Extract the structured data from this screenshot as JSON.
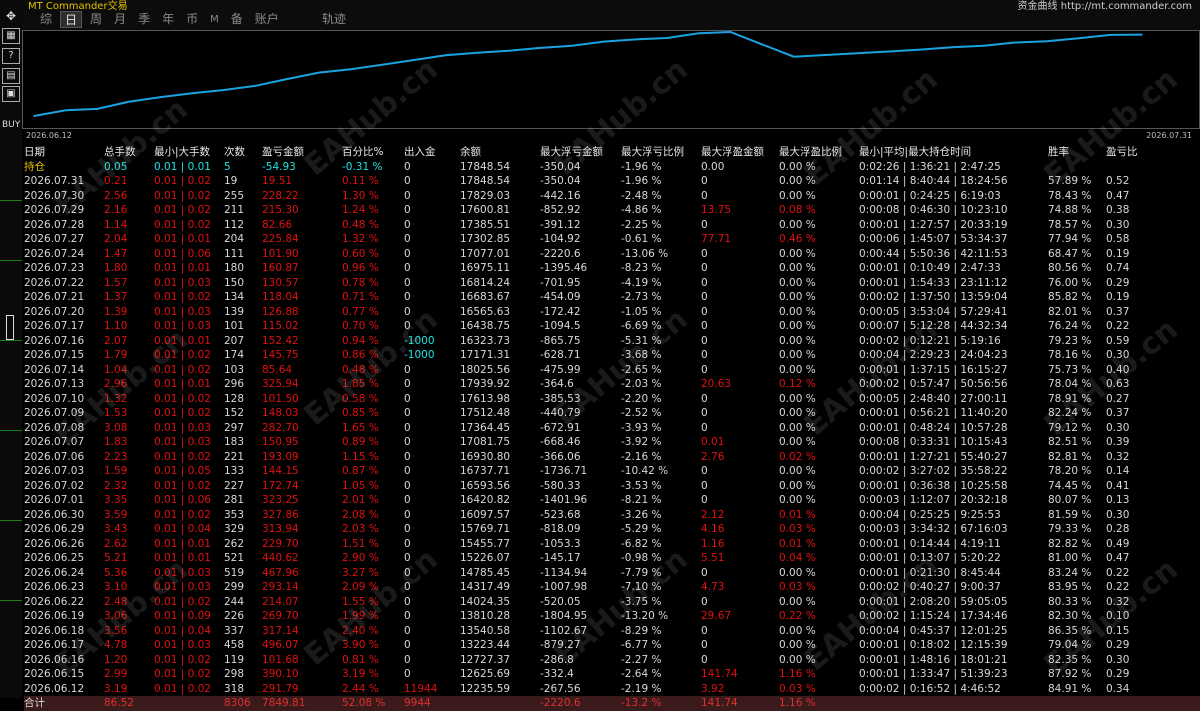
{
  "app": {
    "brand": "MT Commander交易",
    "top_right": "资金曲线 http://mt.commander.com"
  },
  "toolbar": {
    "tabs": [
      "综",
      "日",
      "周",
      "月",
      "季",
      "年",
      "币",
      "M",
      "备",
      "账户"
    ],
    "active_tab": "日",
    "trajectory_label": "轨迹"
  },
  "left_tools": {
    "move_icon": "move-icon",
    "buy_label": "BUY"
  },
  "chart_data": {
    "type": "line",
    "title": "",
    "x_start_label": "2026.06.12",
    "x_end_label": "2026.07.31",
    "x": [
      "2026.06.12",
      "2026.06.15",
      "2026.06.16",
      "2026.06.17",
      "2026.06.18",
      "2026.06.19",
      "2026.06.22",
      "2026.06.23",
      "2026.06.24",
      "2026.06.25",
      "2026.06.26",
      "2026.06.29",
      "2026.06.30",
      "2026.07.01",
      "2026.07.02",
      "2026.07.03",
      "2026.07.06",
      "2026.07.07",
      "2026.07.08",
      "2026.07.09",
      "2026.07.10",
      "2026.07.13",
      "2026.07.14",
      "2026.07.15",
      "2026.07.16",
      "2026.07.17",
      "2026.07.20",
      "2026.07.21",
      "2026.07.22",
      "2026.07.23",
      "2026.07.24",
      "2026.07.27",
      "2026.07.28",
      "2026.07.29",
      "2026.07.30",
      "2026.07.31"
    ],
    "values": [
      12235.59,
      12625.69,
      12727.37,
      13223.44,
      13540.58,
      13810.28,
      14024.35,
      14317.49,
      14785.45,
      15226.07,
      15455.77,
      15769.71,
      16097.57,
      16420.82,
      16593.56,
      16737.71,
      16930.8,
      17081.75,
      17364.45,
      17512.48,
      17613.98,
      17939.92,
      18025.56,
      17171.31,
      16323.73,
      16438.75,
      16565.63,
      16683.67,
      16814.24,
      16975.11,
      17077.01,
      17302.85,
      17385.51,
      17600.81,
      17829.03,
      17848.54
    ],
    "line_color": "#1aa3e0"
  },
  "table": {
    "headers": [
      "日期",
      "总手数",
      "最小|大手数",
      "次数",
      "盈亏金额",
      "百分比%",
      "出入金",
      "余额",
      "最大浮亏金额",
      "最大浮亏比例",
      "最大浮盈金额",
      "最大浮盈比例",
      "最小|平均|最大持仓时间",
      "胜率",
      "盈亏比"
    ],
    "rows": [
      [
        "持仓",
        "0.05",
        "0.01 | 0.01",
        "5",
        "-54.93",
        "-0.31 %",
        "0",
        "17848.54",
        "-350.04",
        "-1.96 %",
        "0.00",
        "0.00 %",
        "0:02:26 | 1:36:21 | 2:47:25",
        "",
        ""
      ],
      [
        "2026.07.31",
        "0.21",
        "0.01 | 0.02",
        "19",
        "19.51",
        "0.11 %",
        "0",
        "17848.54",
        "-350.04",
        "-1.96 %",
        "0",
        "0.00 %",
        "0:01:14 | 8:40:44 | 18:24:56",
        "57.89 %",
        "0.52"
      ],
      [
        "2026.07.30",
        "2.56",
        "0.01 | 0.02",
        "255",
        "228.22",
        "1.30 %",
        "0",
        "17829.03",
        "-442.16",
        "-2.48 %",
        "0",
        "0.00 %",
        "0:00:01 | 0:24:25 | 6:19:03",
        "78.43 %",
        "0.47"
      ],
      [
        "2026.07.29",
        "2.16",
        "0.01 | 0.02",
        "211",
        "215.30",
        "1.24 %",
        "0",
        "17600.81",
        "-852.92",
        "-4.86 %",
        "13.75",
        "0.08 %",
        "0:00:08 | 0:46:30 | 10:23:10",
        "74.88 %",
        "0.38"
      ],
      [
        "2026.07.28",
        "1.14",
        "0.01 | 0.02",
        "112",
        "82.66",
        "0.48 %",
        "0",
        "17385.51",
        "-391.12",
        "-2.25 %",
        "0",
        "0.00 %",
        "0:00:01 | 1:27:57 | 20:33:19",
        "78.57 %",
        "0.30"
      ],
      [
        "2026.07.27",
        "2.04",
        "0.01 | 0.01",
        "204",
        "225.84",
        "1.32 %",
        "0",
        "17302.85",
        "-104.92",
        "-0.61 %",
        "77.71",
        "0.46 %",
        "0:00:06 | 1:45:07 | 53:34:37",
        "77.94 %",
        "0.58"
      ],
      [
        "2026.07.24",
        "1.47",
        "0.01 | 0.06",
        "111",
        "101.90",
        "0.60 %",
        "0",
        "17077.01",
        "-2220.6",
        "-13.06 %",
        "0",
        "0.00 %",
        "0:00:44 | 5:50:36 | 42:11:53",
        "68.47 %",
        "0.19"
      ],
      [
        "2026.07.23",
        "1.80",
        "0.01 | 0.01",
        "180",
        "160.87",
        "0.96 %",
        "0",
        "16975.11",
        "-1395.46",
        "-8.23 %",
        "0",
        "0.00 %",
        "0:00:01 | 0:10:49 | 2:47:33",
        "80.56 %",
        "0.74"
      ],
      [
        "2026.07.22",
        "1.57",
        "0.01 | 0.03",
        "150",
        "130.57",
        "0.78 %",
        "0",
        "16814.24",
        "-701.95",
        "-4.19 %",
        "0",
        "0.00 %",
        "0:00:01 | 1:54:33 | 23:11:12",
        "76.00 %",
        "0.29"
      ],
      [
        "2026.07.21",
        "1.37",
        "0.01 | 0.02",
        "134",
        "118.04",
        "0.71 %",
        "0",
        "16683.67",
        "-454.09",
        "-2.73 %",
        "0",
        "0.00 %",
        "0:00:02 | 1:37:50 | 13:59:04",
        "85.82 %",
        "0.19"
      ],
      [
        "2026.07.20",
        "1.39",
        "0.01 | 0.03",
        "139",
        "126.88",
        "0.77 %",
        "0",
        "16565.63",
        "-172.42",
        "-1.05 %",
        "0",
        "0.00 %",
        "0:00:05 | 3:53:04 | 57:29:41",
        "82.01 %",
        "0.37"
      ],
      [
        "2026.07.17",
        "1.10",
        "0.01 | 0.03",
        "101",
        "115.02",
        "0.70 %",
        "0",
        "16438.75",
        "-1094.5",
        "-6.69 %",
        "0",
        "0.00 %",
        "0:00:07 | 5:12:28 | 44:32:34",
        "76.24 %",
        "0.22"
      ],
      [
        "2026.07.16",
        "2.07",
        "0.01 | 0.01",
        "207",
        "152.42",
        "0.94 %",
        "-1000",
        "16323.73",
        "-865.75",
        "-5.31 %",
        "0",
        "0.00 %",
        "0:00:02 | 0:12:21 | 5:19:16",
        "79.23 %",
        "0.59"
      ],
      [
        "2026.07.15",
        "1.79",
        "0.01 | 0.02",
        "174",
        "145.75",
        "0.86 %",
        "-1000",
        "17171.31",
        "-628.71",
        "-3.68 %",
        "0",
        "0.00 %",
        "0:00:04 | 2:29:23 | 24:04:23",
        "78.16 %",
        "0.30"
      ],
      [
        "2026.07.14",
        "1.04",
        "0.01 | 0.02",
        "103",
        "85.64",
        "0.48 %",
        "0",
        "18025.56",
        "-475.99",
        "-2.65 %",
        "0",
        "0.00 %",
        "0:00:01 | 1:37:15 | 16:15:27",
        "75.73 %",
        "0.40"
      ],
      [
        "2026.07.13",
        "2.96",
        "0.01 | 0.01",
        "296",
        "325.94",
        "1.85 %",
        "0",
        "17939.92",
        "-364.6",
        "-2.03 %",
        "20.63",
        "0.12 %",
        "0:00:02 | 0:57:47 | 50:56:56",
        "78.04 %",
        "0.63"
      ],
      [
        "2026.07.10",
        "1.32",
        "0.01 | 0.02",
        "128",
        "101.50",
        "0.58 %",
        "0",
        "17613.98",
        "-385.53",
        "-2.20 %",
        "0",
        "0.00 %",
        "0:00:05 | 2:48:40 | 27:00:11",
        "78.91 %",
        "0.27"
      ],
      [
        "2026.07.09",
        "1.53",
        "0.01 | 0.02",
        "152",
        "148.03",
        "0.85 %",
        "0",
        "17512.48",
        "-440.79",
        "-2.52 %",
        "0",
        "0.00 %",
        "0:00:01 | 0:56:21 | 11:40:20",
        "82.24 %",
        "0.37"
      ],
      [
        "2026.07.08",
        "3.08",
        "0.01 | 0.03",
        "297",
        "282.70",
        "1.65 %",
        "0",
        "17364.45",
        "-672.91",
        "-3.93 %",
        "0",
        "0.00 %",
        "0:00:01 | 0:48:24 | 10:57:28",
        "79.12 %",
        "0.30"
      ],
      [
        "2026.07.07",
        "1.83",
        "0.01 | 0.03",
        "183",
        "150.95",
        "0.89 %",
        "0",
        "17081.75",
        "-668.46",
        "-3.92 %",
        "0.01",
        "0.00 %",
        "0:00:08 | 0:33:31 | 10:15:43",
        "82.51 %",
        "0.39"
      ],
      [
        "2026.07.06",
        "2.23",
        "0.01 | 0.02",
        "221",
        "193.09",
        "1.15 %",
        "0",
        "16930.80",
        "-366.06",
        "-2.16 %",
        "2.76",
        "0.02 %",
        "0:00:01 | 1:27:21 | 55:40:27",
        "82.81 %",
        "0.32"
      ],
      [
        "2026.07.03",
        "1.59",
        "0.01 | 0.05",
        "133",
        "144.15",
        "0.87 %",
        "0",
        "16737.71",
        "-1736.71",
        "-10.42 %",
        "0",
        "0.00 %",
        "0:00:02 | 3:27:02 | 35:58:22",
        "78.20 %",
        "0.14"
      ],
      [
        "2026.07.02",
        "2.32",
        "0.01 | 0.02",
        "227",
        "172.74",
        "1.05 %",
        "0",
        "16593.56",
        "-580.33",
        "-3.53 %",
        "0",
        "0.00 %",
        "0:00:01 | 0:36:38 | 10:25:58",
        "74.45 %",
        "0.41"
      ],
      [
        "2026.07.01",
        "3.35",
        "0.01 | 0.06",
        "281",
        "323.25",
        "2.01 %",
        "0",
        "16420.82",
        "-1401.96",
        "-8.21 %",
        "0",
        "0.00 %",
        "0:00:03 | 1:12:07 | 20:32:18",
        "80.07 %",
        "0.13"
      ],
      [
        "2026.06.30",
        "3.59",
        "0.01 | 0.02",
        "353",
        "327.86",
        "2.08 %",
        "0",
        "16097.57",
        "-523.68",
        "-3.26 %",
        "2.12",
        "0.01 %",
        "0:00:04 | 0:25:25 | 9:25:53",
        "81.59 %",
        "0.30"
      ],
      [
        "2026.06.29",
        "3.43",
        "0.01 | 0.04",
        "329",
        "313.94",
        "2.03 %",
        "0",
        "15769.71",
        "-818.09",
        "-5.29 %",
        "4.16",
        "0.03 %",
        "0:00:03 | 3:34:32 | 67:16:03",
        "79.33 %",
        "0.28"
      ],
      [
        "2026.06.26",
        "2.62",
        "0.01 | 0.01",
        "262",
        "229.70",
        "1.51 %",
        "0",
        "15455.77",
        "-1053.3",
        "-6.82 %",
        "1.16",
        "0.01 %",
        "0:00:01 | 0:14:44 | 4:19:11",
        "82.82 %",
        "0.49"
      ],
      [
        "2026.06.25",
        "5.21",
        "0.01 | 0.01",
        "521",
        "440.62",
        "2.90 %",
        "0",
        "15226.07",
        "-145.17",
        "-0.98 %",
        "5.51",
        "0.04 %",
        "0:00:01 | 0:13:07 | 5:20:22",
        "81.00 %",
        "0.47"
      ],
      [
        "2026.06.24",
        "5.36",
        "0.01 | 0.03",
        "519",
        "467.96",
        "3.27 %",
        "0",
        "14785.45",
        "-1134.94",
        "-7.79 %",
        "0",
        "0.00 %",
        "0:00:01 | 0:21:30 | 8:45:44",
        "83.24 %",
        "0.22"
      ],
      [
        "2026.06.23",
        "3.10",
        "0.01 | 0.03",
        "299",
        "293.14",
        "2.09 %",
        "0",
        "14317.49",
        "-1007.98",
        "-7.10 %",
        "4.73",
        "0.03 %",
        "0:00:02 | 0:40:27 | 9:00:37",
        "83.95 %",
        "0.22"
      ],
      [
        "2026.06.22",
        "2.48",
        "0.01 | 0.02",
        "244",
        "214.07",
        "1.55 %",
        "0",
        "14024.35",
        "-520.05",
        "-3.75 %",
        "0",
        "0.00 %",
        "0:00:01 | 2:08:20 | 59:05:05",
        "80.33 %",
        "0.32"
      ],
      [
        "2026.06.19",
        "3.06",
        "0.01 | 0.09",
        "226",
        "269.70",
        "1.99 %",
        "0",
        "13810.28",
        "-1804.95",
        "-13.20 %",
        "29.67",
        "0.22 %",
        "0:00:02 | 1:15:24 | 17:34:46",
        "82.30 %",
        "0.10"
      ],
      [
        "2026.06.18",
        "3.56",
        "0.01 | 0.04",
        "337",
        "317.14",
        "2.40 %",
        "0",
        "13540.58",
        "-1102.67",
        "-8.29 %",
        "0",
        "0.00 %",
        "0:00:04 | 0:45:37 | 12:01:25",
        "86.35 %",
        "0.15"
      ],
      [
        "2026.06.17",
        "4.78",
        "0.01 | 0.03",
        "458",
        "496.07",
        "3.90 %",
        "0",
        "13223.44",
        "-879.27",
        "-6.77 %",
        "0",
        "0.00 %",
        "0:00:01 | 0:18:02 | 12:15:39",
        "79.04 %",
        "0.29"
      ],
      [
        "2026.06.16",
        "1.20",
        "0.01 | 0.02",
        "119",
        "101.68",
        "0.81 %",
        "0",
        "12727.37",
        "-286.8",
        "-2.27 %",
        "0",
        "0.00 %",
        "0:00:01 | 1:48:16 | 18:01:21",
        "82.35 %",
        "0.30"
      ],
      [
        "2026.06.15",
        "2.99",
        "0.01 | 0.02",
        "298",
        "390.10",
        "3.19 %",
        "0",
        "12625.69",
        "-332.4",
        "-2.64 %",
        "141.74",
        "1.16 %",
        "0:00:01 | 1:33:47 | 51:39:23",
        "87.92 %",
        "0.29"
      ],
      [
        "2026.06.12",
        "3.19",
        "0.01 | 0.02",
        "318",
        "291.79",
        "2.44 %",
        "11944",
        "12235.59",
        "-267.56",
        "-2.19 %",
        "3.92",
        "0.03 %",
        "0:00:02 | 0:16:52 | 4:46:52",
        "84.91 %",
        "0.34"
      ]
    ],
    "summary": [
      "合计",
      "86.52",
      "",
      "8306",
      "7849.81",
      "52.08 %",
      "9944",
      "",
      "-2220.6",
      "-13.2 %",
      "141.74",
      "1.16 %",
      "",
      "",
      ""
    ]
  },
  "watermark": "EAHub.cn",
  "colors": {
    "background": "#000000",
    "positive": "#e01010",
    "line": "#1aa3e0",
    "accent": "#e7c200",
    "cyan": "#20e0e0"
  }
}
